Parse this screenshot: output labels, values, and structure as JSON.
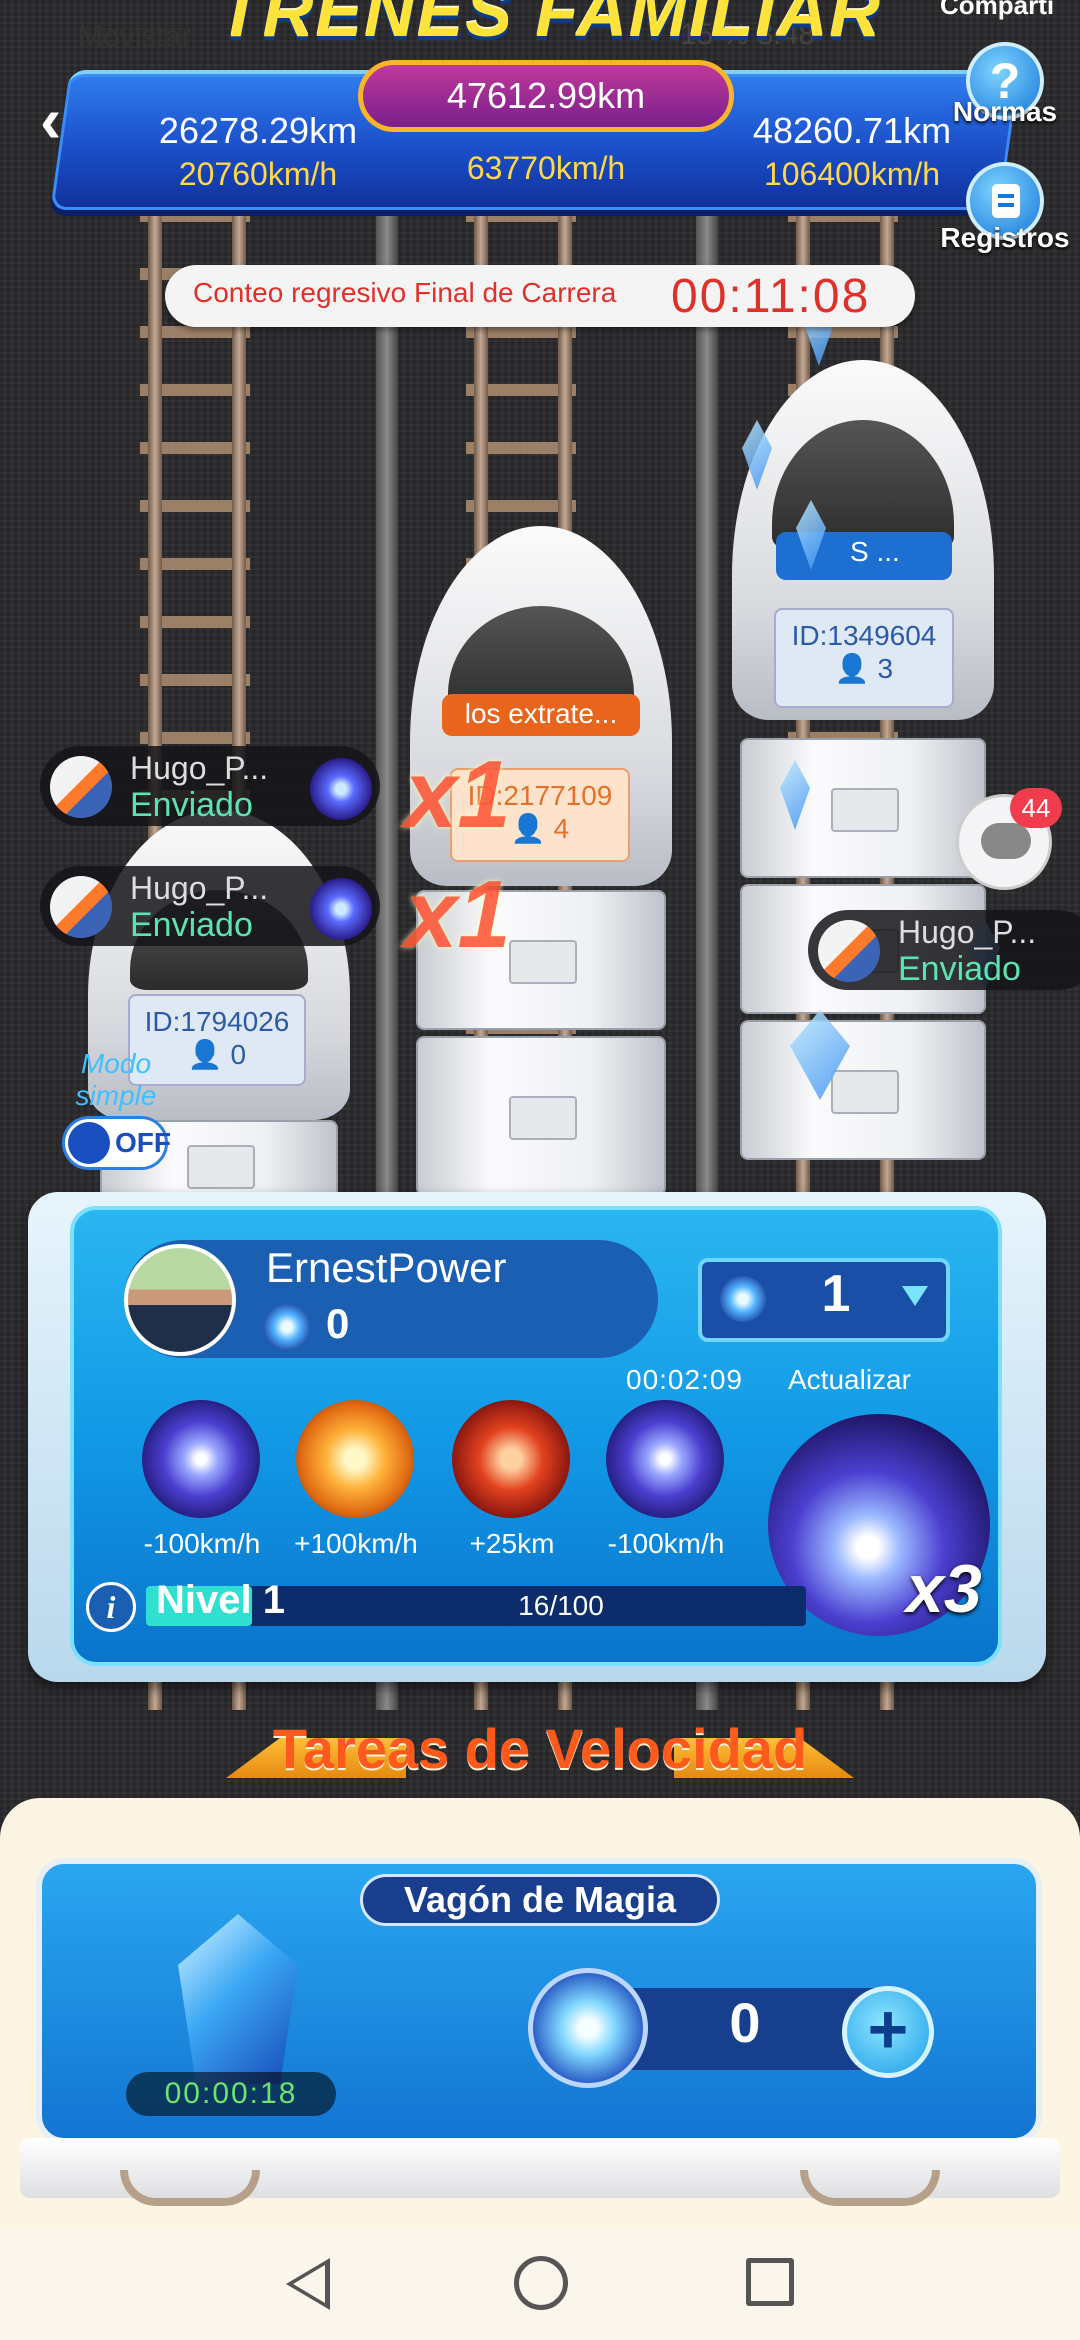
{
  "status_bar": {
    "carrier": "Movistar",
    "right": "15 %  8:48"
  },
  "header": {
    "title": "TRENES FAMILIAR",
    "share_label": "Comparti",
    "total_distance": "47612.99km",
    "lanes": [
      {
        "distance": "26278.29km",
        "speed": "20760km/h"
      },
      {
        "distance": "",
        "speed": "63770km/h"
      },
      {
        "distance": "48260.71km",
        "speed": "106400km/h"
      }
    ],
    "rules_label": "Normas",
    "records_label": "Registros"
  },
  "countdown": {
    "label": "Conteo regresivo Final de Carrera",
    "time": "00:11:08"
  },
  "trains": [
    {
      "name_tag": "",
      "id": "ID:1794026",
      "members": "0"
    },
    {
      "name_tag": "los extrate...",
      "id": "ID:2177109",
      "members": "4"
    },
    {
      "name_tag": "S ...",
      "id": "ID:1349604",
      "members": "3"
    }
  ],
  "senders": [
    {
      "name": "Hugo_P...",
      "status": "Enviado"
    },
    {
      "name": "Hugo_P...",
      "status": "Enviado"
    },
    {
      "name": "Hugo_P...",
      "status": "Enviado"
    }
  ],
  "multipliers": [
    "x1",
    "x1"
  ],
  "chat": {
    "badge": "44"
  },
  "simple_mode": {
    "label": "Modo simple",
    "toggle": "OFF"
  },
  "player": {
    "name": "ErnestPower",
    "gems": "0",
    "quantity": "1",
    "timer": "00:02:09",
    "refresh_label": "Actualizar",
    "skills": [
      {
        "icon": "crystal-burst-icon",
        "label": "-100km/h"
      },
      {
        "icon": "fire-burst-icon",
        "label": "+100km/h"
      },
      {
        "icon": "fire-spring-icon",
        "label": "+25km"
      },
      {
        "icon": "crystal-burst-icon",
        "label": "-100km/h"
      }
    ],
    "big_skill_multiplier": "x3",
    "level_label": "Nivel 1",
    "level_progress": "16/100",
    "level_fraction": 0.16
  },
  "tasks": {
    "title": "Tareas de Velocidad",
    "wagon_title": "Vagón de Magia",
    "wagon_timer": "00:00:18",
    "gem_count": "0"
  },
  "colors": {
    "accent_blue": "#1299e6",
    "countdown_red": "#e0302a",
    "task_orange": "#ff5a1c",
    "sent_green": "#5ce3b0"
  }
}
